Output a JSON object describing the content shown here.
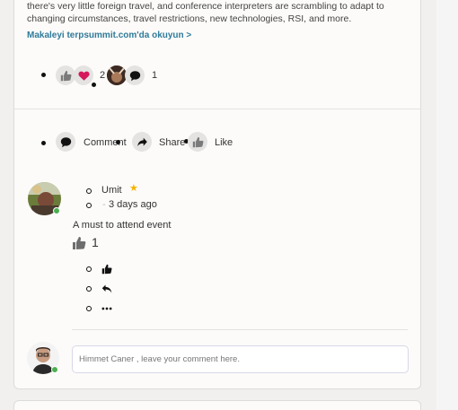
{
  "article": {
    "excerpt": "there's very little foreign travel, and conference interpreters are scrambling to adapt to changing circumstances, travel restrictions, new technologies, RSI, and more.",
    "read_more": "Makaleyi terpsummit.com'da okuyun >"
  },
  "reactions": {
    "like_icon": "thumbs-up-icon",
    "love_icon": "heart-icon",
    "reaction_count": "2",
    "comment_count": "1"
  },
  "actions": {
    "comment_label": "Comment",
    "share_label": "Share",
    "like_label": "Like"
  },
  "comment": {
    "author": "Umit",
    "time": "3 days ago",
    "time_prefix": "-",
    "text": "A must to attend event",
    "like_count": "1",
    "badge_color": "#f5b400"
  },
  "composer": {
    "placeholder": "Himmet Caner , leave your comment here."
  },
  "colors": {
    "accent": "#2e7a9a",
    "online": "#4caf50",
    "love": "#d6175b"
  }
}
